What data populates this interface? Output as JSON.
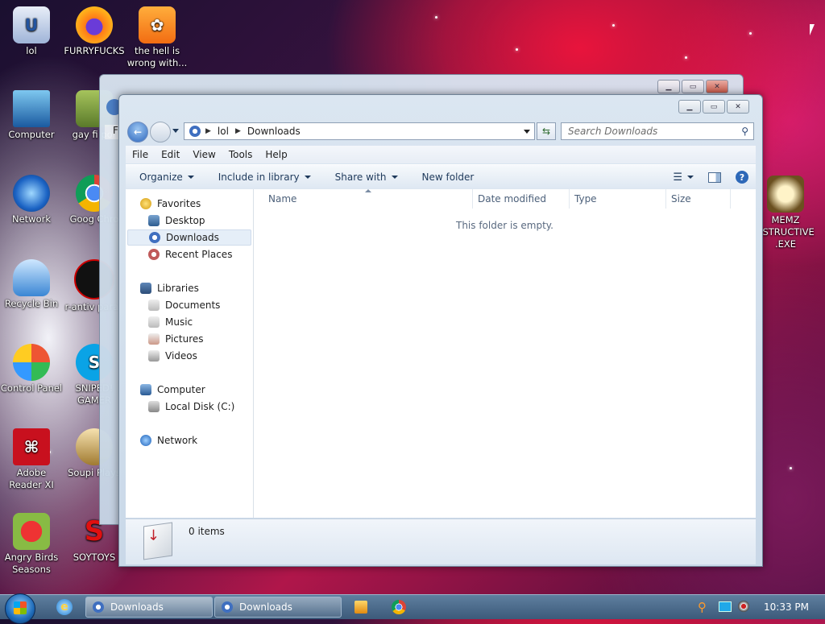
{
  "desktop": {
    "icons_left": [
      {
        "label": "lol"
      },
      {
        "label": "Computer"
      },
      {
        "label": "Network"
      },
      {
        "label": "Recycle Bin"
      },
      {
        "label": "Control Panel"
      },
      {
        "label": "Adobe Reader XI"
      },
      {
        "label": "Angry Birds Seasons"
      }
    ],
    "icons_col2": [
      {
        "label": "FURRYFUCKS"
      },
      {
        "label": "gay fi por"
      },
      {
        "label": "Goog Chro"
      },
      {
        "label": "r-antiv parac"
      },
      {
        "label": "SNIPED! GAMER"
      },
      {
        "label": "Soupi Plays"
      },
      {
        "label": "SOYTOYS"
      }
    ],
    "icon_uc": {
      "label": "the hell is wrong with..."
    },
    "icon_memz": {
      "label": "MEMZ ESTRUCTIVE .EXE"
    }
  },
  "window": {
    "back_window_partial_label": "F",
    "address": {
      "segments": [
        "lol",
        "Downloads"
      ]
    },
    "search": {
      "placeholder": "Search Downloads"
    },
    "menu": [
      "File",
      "Edit",
      "View",
      "Tools",
      "Help"
    ],
    "commands": {
      "organize": "Organize",
      "include": "Include in library",
      "share": "Share with",
      "new_folder": "New folder"
    },
    "nav": {
      "favorites": "Favorites",
      "desktop": "Desktop",
      "downloads": "Downloads",
      "recent": "Recent Places",
      "libraries": "Libraries",
      "documents": "Documents",
      "music": "Music",
      "pictures": "Pictures",
      "videos": "Videos",
      "computer": "Computer",
      "local_disk": "Local Disk (C:)",
      "network": "Network"
    },
    "columns": [
      "Name",
      "Date modified",
      "Type",
      "Size"
    ],
    "empty_message": "This folder is empty.",
    "details": {
      "count": "0 items"
    }
  },
  "taskbar": {
    "buttons": [
      "Downloads",
      "Downloads"
    ],
    "clock": "10:33 PM"
  },
  "colors": {
    "accent": "#1e395b",
    "selected": "#e5eef8"
  }
}
